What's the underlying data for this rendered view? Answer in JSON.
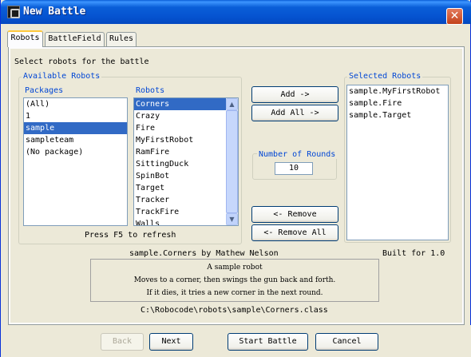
{
  "window": {
    "title": "New Battle",
    "close_glyph": "✕"
  },
  "tabs": [
    {
      "label": "Robots",
      "active": true
    },
    {
      "label": "BattleField",
      "active": false
    },
    {
      "label": "Rules",
      "active": false
    }
  ],
  "instructions": "Select robots for the battle",
  "available": {
    "group_title": "Available Robots",
    "packages_header": "Packages",
    "robots_header": "Robots",
    "packages": [
      "(All)",
      "1",
      "sample",
      "sampleteam",
      "(No package)"
    ],
    "packages_selected_index": 2,
    "robots": [
      "Corners",
      "Crazy",
      "Fire",
      "MyFirstRobot",
      "RamFire",
      "SittingDuck",
      "SpinBot",
      "Target",
      "Tracker",
      "TrackFire",
      "Walls"
    ],
    "robots_selected_index": 0,
    "refresh_hint": "Press F5 to refresh"
  },
  "buttons": {
    "add": "Add ->",
    "add_all": "Add All ->",
    "remove": "<- Remove",
    "remove_all": "<- Remove All"
  },
  "rounds": {
    "label": "Number of Rounds",
    "value": "10"
  },
  "selected": {
    "group_title": "Selected Robots",
    "robots": [
      "sample.MyFirstRobot",
      "sample.Fire",
      "sample.Target"
    ]
  },
  "robot_info": {
    "name_author": "sample.Corners by Mathew Nelson",
    "built_for": "Built for 1.0",
    "description": [
      "A sample robot",
      "Moves to a corner, then swings the gun back and forth.",
      "If it dies, it tries a new corner in the next round."
    ],
    "path": "C:\\Robocode\\robots\\sample\\Corners.class"
  },
  "footer": {
    "back": "Back",
    "next": "Next",
    "start": "Start Battle",
    "cancel": "Cancel"
  },
  "colors": {
    "title_bar": "#0a5fd8",
    "selection": "#316ac5",
    "group_title": "#0046d5",
    "active_tab_accent": "#ffc83c"
  }
}
